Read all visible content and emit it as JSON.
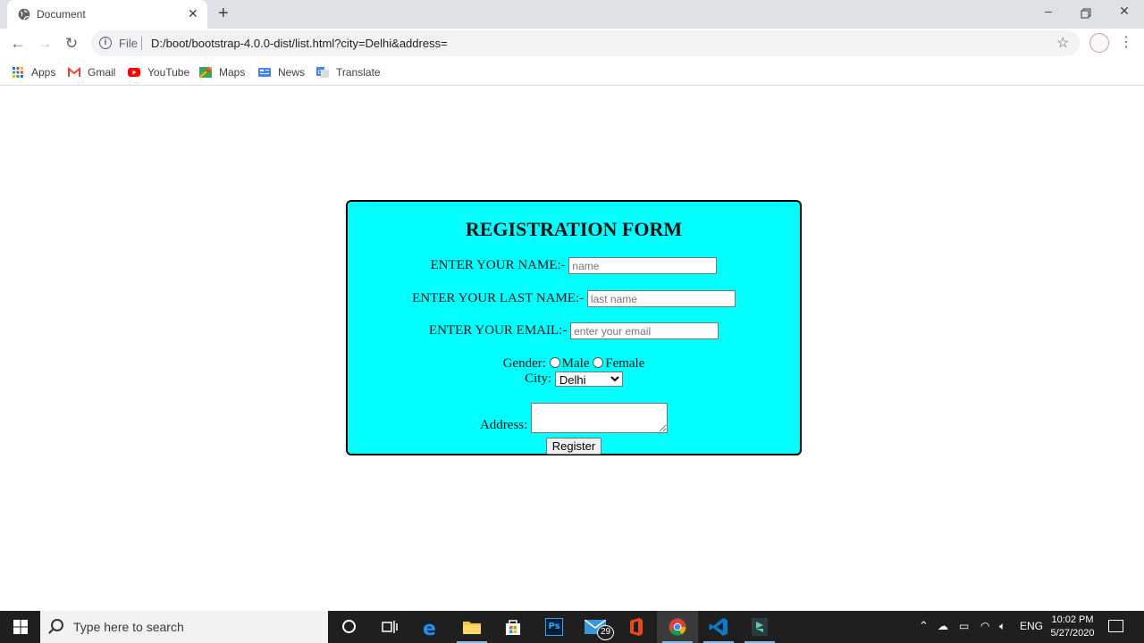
{
  "browser": {
    "tab_title": "Document",
    "scheme_label": "File",
    "url": "D:/boot/bootstrap-4.0.0-dist/list.html?city=Delhi&address=",
    "bookmarks": [
      {
        "label": "Apps",
        "icon": "apps-grid-icon"
      },
      {
        "label": "Gmail",
        "icon": "gmail-icon"
      },
      {
        "label": "YouTube",
        "icon": "youtube-icon"
      },
      {
        "label": "Maps",
        "icon": "maps-icon"
      },
      {
        "label": "News",
        "icon": "news-icon"
      },
      {
        "label": "Translate",
        "icon": "translate-icon"
      }
    ]
  },
  "form": {
    "title": "REGISTRATION FORM",
    "name_label": "ENTER YOUR NAME:-",
    "name_placeholder": "name",
    "lastname_label": "ENTER YOUR LAST NAME:-",
    "lastname_placeholder": "last name",
    "email_label": "ENTER YOUR EMAIL:-",
    "email_placeholder": "enter your email",
    "gender_label": "Gender:",
    "gender_options": [
      "Male",
      "Female"
    ],
    "city_label": "City:",
    "city_selected": "Delhi",
    "address_label": "Address:",
    "register_label": "Register",
    "background_color": "#00ffff"
  },
  "taskbar": {
    "search_placeholder": "Type here to search",
    "mail_badge": "29",
    "language": "ENG",
    "time": "10:02 PM",
    "date": "5/27/2020"
  }
}
